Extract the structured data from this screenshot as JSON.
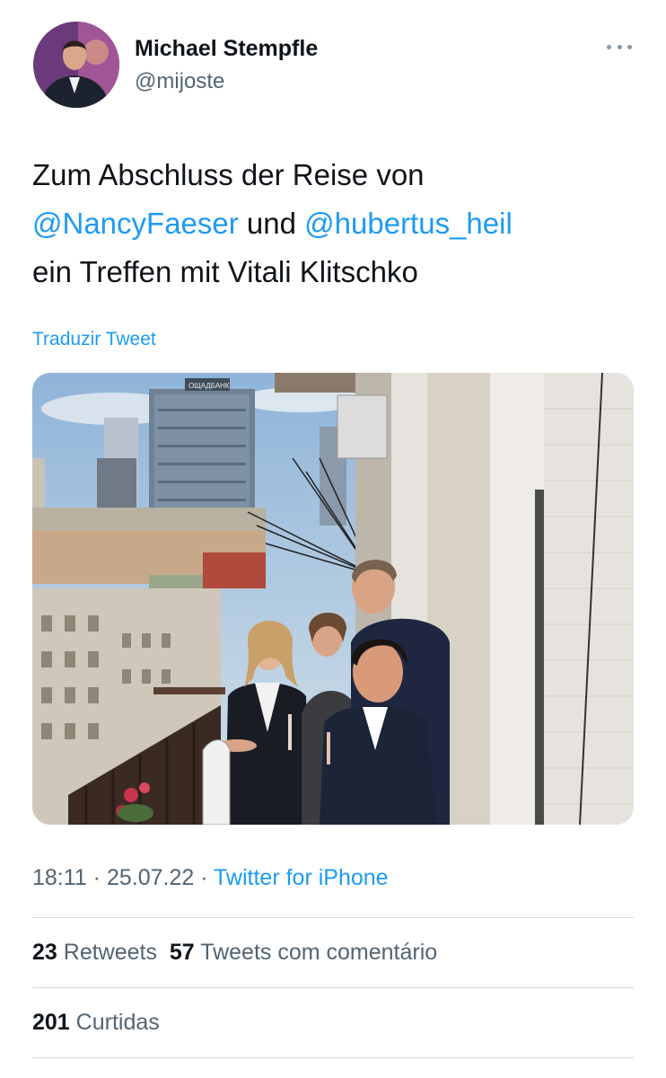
{
  "author": {
    "name": "Michael Stempfle",
    "handle": "@mijoste",
    "avatar_icon": "profile-photo"
  },
  "tweet": {
    "line1": "Zum Abschluss der Reise von",
    "mention1": "@NancyFaeser",
    "connector": " und ",
    "mention2": "@hubertus_heil",
    "line3": "ein Treffen mit Vitali Klitschko"
  },
  "translate_label": "Traduzir Tweet",
  "media": {
    "building_sign": "OЩАДБАНК"
  },
  "meta": {
    "time": "18:11",
    "separator": " · ",
    "date": "25.07.22",
    "source": "Twitter for iPhone"
  },
  "stats": {
    "retweets_count": "23",
    "retweets_label": "Retweets",
    "quotes_count": "57",
    "quotes_label": "Tweets com comentário",
    "likes_count": "201",
    "likes_label": "Curtidas"
  },
  "colors": {
    "link": "#1d9bf0",
    "secondary_text": "#536471",
    "primary_text": "#0f1419",
    "divider": "#cfd9de"
  }
}
